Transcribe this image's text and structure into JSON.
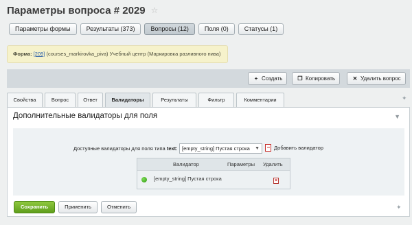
{
  "header": {
    "title": "Параметры вопроса # 2029",
    "star_icon": "☆"
  },
  "top_tabs": [
    {
      "label": "Параметры формы",
      "active": false
    },
    {
      "label": "Результаты (373)",
      "active": false
    },
    {
      "label": "Вопросы (12)",
      "active": true
    },
    {
      "label": "Поля (0)",
      "active": false
    },
    {
      "label": "Статусы (1)",
      "active": false
    }
  ],
  "notice": {
    "label": "Форма:",
    "link": "[209]",
    "text": "(courses_markirovka_piva) Учебный центр (Маркировка разливного пива)"
  },
  "toolbar": {
    "create": {
      "icon": "+",
      "label": "Создать"
    },
    "copy": {
      "icon": "❐",
      "label": "Копировать"
    },
    "delete": {
      "icon": "✕",
      "label": "Удалить вопрос"
    }
  },
  "tabs": [
    {
      "label": "Свойства",
      "active": false
    },
    {
      "label": "Вопрос",
      "active": false
    },
    {
      "label": "Ответ",
      "active": false
    },
    {
      "label": "Валидаторы",
      "active": true
    },
    {
      "label": "Результаты",
      "active": false
    },
    {
      "label": "Фильтр",
      "active": false
    },
    {
      "label": "Комментарии",
      "active": false
    }
  ],
  "panel": {
    "title": "Дополнительные валидаторы для поля",
    "available_label": "Доступные валидаторы для поля типа",
    "field_type": "text:",
    "select_value": "[empty_string] Пустая строка",
    "add_label": "Добавить валидатор",
    "table": {
      "headers": {
        "validator": "Валидатор",
        "params": "Параметры",
        "delete": "Удалить"
      },
      "rows": [
        {
          "name": "[empty_string] Пустая строка",
          "params": ""
        }
      ]
    }
  },
  "footer": {
    "save": "Сохранить",
    "apply": "Применить",
    "cancel": "Отменить"
  },
  "colors": {
    "primary_button": "#6fae27",
    "notice_bg": "#f6f2cb",
    "toolbar_bg": "#d3d9dd"
  }
}
